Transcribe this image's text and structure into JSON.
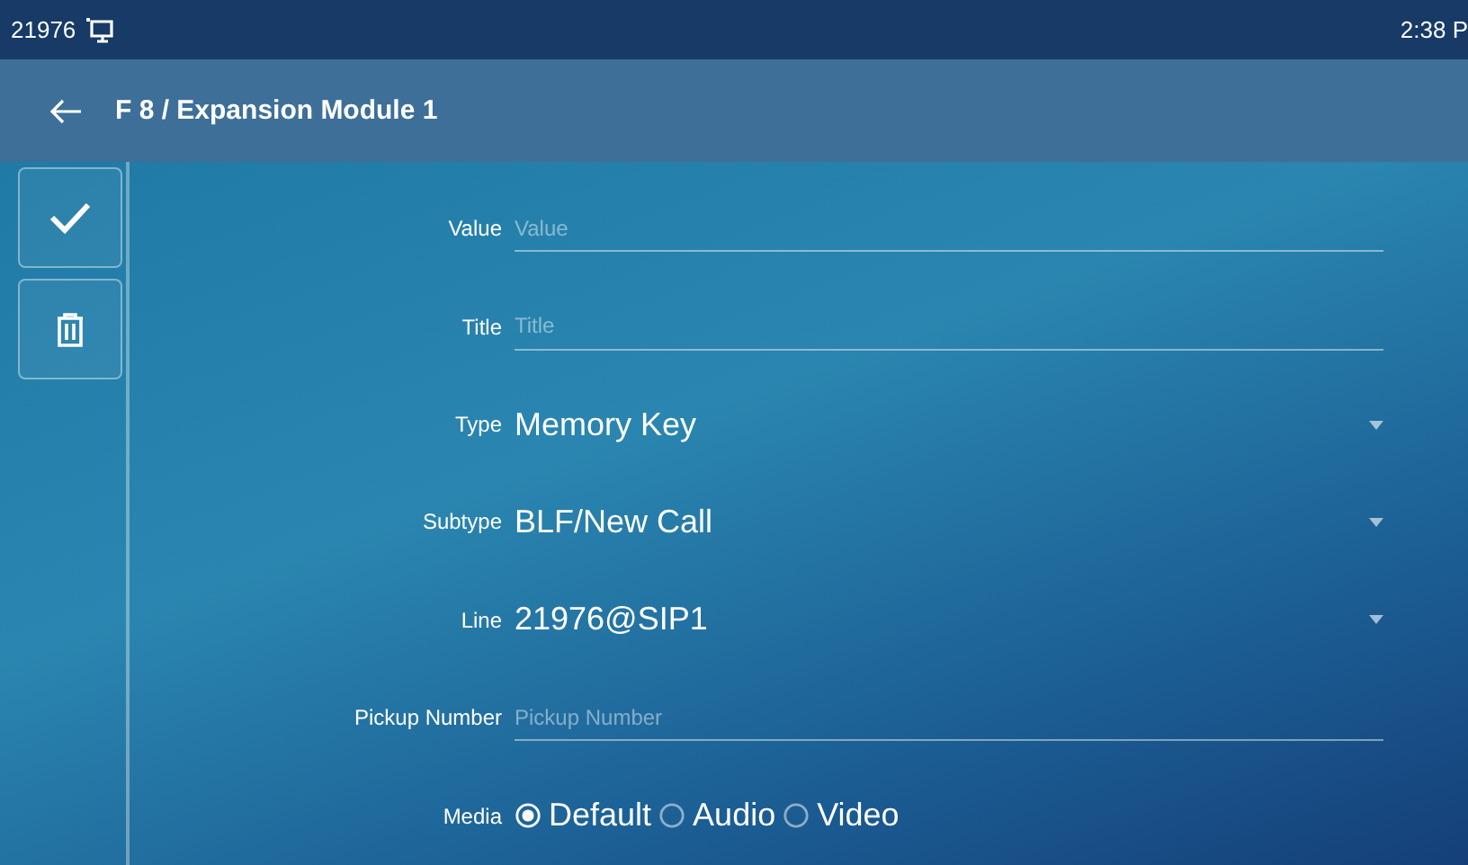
{
  "status_bar": {
    "account": "21976",
    "time": "2:38 P"
  },
  "header": {
    "title": "F 8 / Expansion Module 1"
  },
  "form": {
    "fields": [
      {
        "kind": "text",
        "label": "Value",
        "placeholder": "Value"
      },
      {
        "kind": "text",
        "label": "Title",
        "placeholder": "Title"
      },
      {
        "kind": "select",
        "label": "Type",
        "value": "Memory Key"
      },
      {
        "kind": "select",
        "label": "Subtype",
        "value": "BLF/New Call"
      },
      {
        "kind": "select",
        "label": "Line",
        "value": "21976@SIP1"
      },
      {
        "kind": "text",
        "label": "Pickup Number",
        "placeholder": "Pickup Number"
      },
      {
        "kind": "radio",
        "label": "Media",
        "options": [
          {
            "label": "Default",
            "selected": true
          },
          {
            "label": "Audio",
            "selected": false
          },
          {
            "label": "Video",
            "selected": false
          }
        ]
      }
    ]
  }
}
